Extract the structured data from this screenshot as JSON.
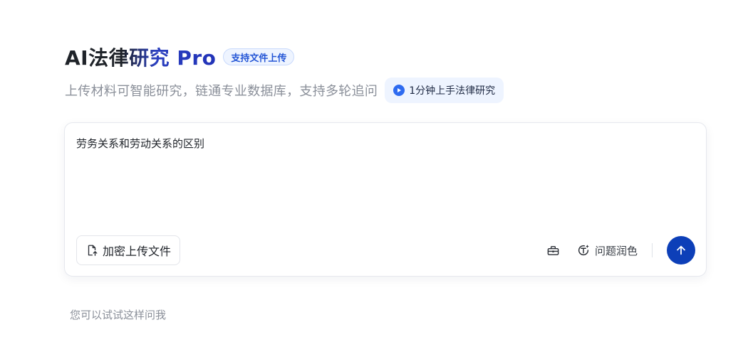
{
  "header": {
    "title": "AI法律研究 Pro",
    "badge": "支持文件上传",
    "subtitle": "上传材料可智能研究，链通专业数据库，支持多轮追问",
    "guide_button": "1分钟上手法律研究"
  },
  "input": {
    "query": "劳务关系和劳动关系的区别",
    "upload_button": "加密上传文件",
    "polish_button": "问题润色",
    "toolbox_icon": "toolbox-icon",
    "polish_icon": "text-sparkle-icon",
    "send_icon": "arrow-up-icon"
  },
  "hint": "您可以试试这样问我",
  "colors": {
    "accent": "#0d3fb8",
    "badge_text": "#2456d6",
    "badge_bg": "#eef4ff"
  }
}
